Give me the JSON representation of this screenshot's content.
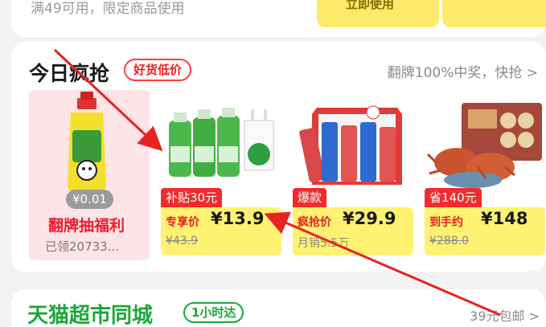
{
  "top": {
    "coupon_text": "满49可用，限定商品使用",
    "button_text": "立即使用"
  },
  "section": {
    "title": "今日疯抢",
    "badge": "好货低价",
    "right_link": "翻牌100%中奖，快抢 >"
  },
  "products": [
    {
      "price_pill": "¥0.01",
      "title": "翻牌抽福利",
      "subtitle": "已领20733..."
    },
    {
      "tag": "补贴30元",
      "price_label": "专享价",
      "price": "¥13.9",
      "sub": "¥43.9"
    },
    {
      "tag": "爆款",
      "price_label": "疯抢价",
      "price": "¥29.9",
      "sub": "月销5.5万"
    },
    {
      "tag": "省140元",
      "price_label": "到手约",
      "price": "¥148",
      "sub": "¥288.0"
    }
  ],
  "bottom": {
    "title": "天猫超市同城",
    "badge": "1小时达",
    "ship_text": "39元包邮 >"
  },
  "colors": {
    "accent_red": "#e81f1f",
    "price_yellow": "#fff272",
    "tmall_green": "#1aa83a",
    "arrow_red": "#e82222"
  }
}
